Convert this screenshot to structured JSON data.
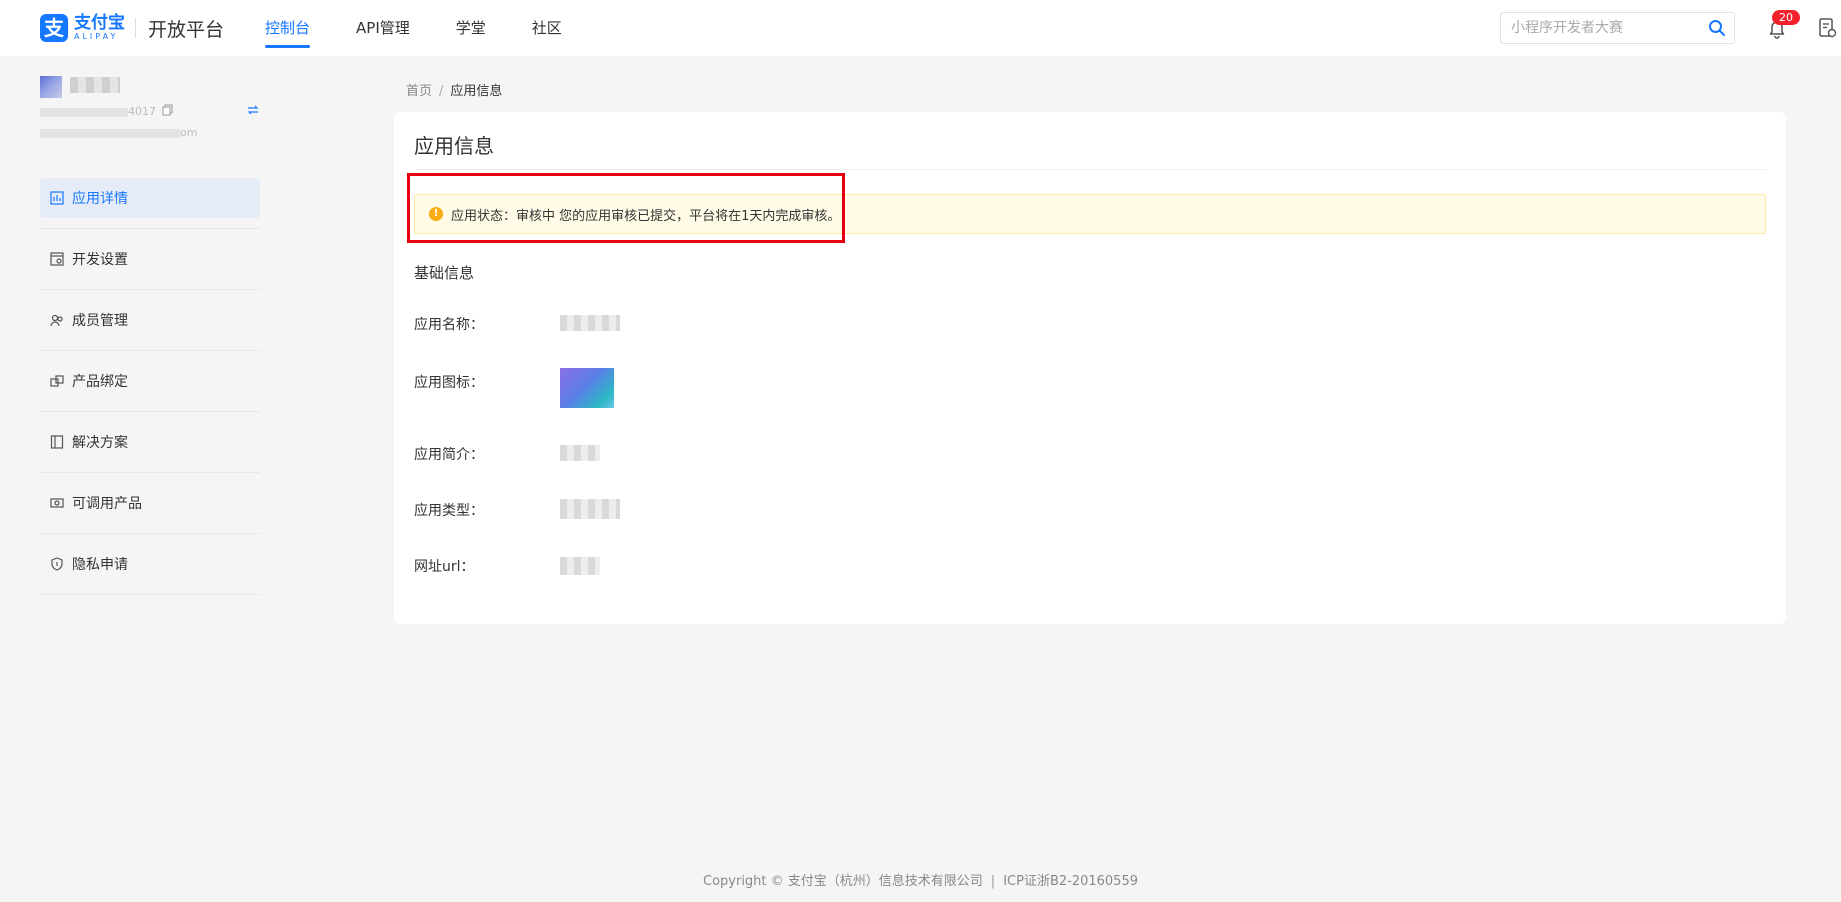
{
  "header": {
    "logo_cn": "支付宝",
    "logo_en": "ALIPAY",
    "platform": "开放平台",
    "nav": [
      {
        "label": "控制台",
        "active": true
      },
      {
        "label": "API管理"
      },
      {
        "label": "学堂"
      },
      {
        "label": "社区"
      }
    ],
    "search_placeholder": "小程序开发者大赛",
    "notification_count": "20",
    "icons": [
      "search-icon",
      "bell-icon",
      "document-icon"
    ]
  },
  "sidebar": {
    "account_id_suffix": "4017",
    "account_email_suffix": "om",
    "menu": [
      {
        "label": "应用详情",
        "icon": "chart-icon",
        "active": true
      },
      {
        "label": "开发设置",
        "icon": "settings-icon"
      },
      {
        "label": "成员管理",
        "icon": "members-icon"
      },
      {
        "label": "产品绑定",
        "icon": "link-icon"
      },
      {
        "label": "解决方案",
        "icon": "book-icon"
      },
      {
        "label": "可调用产品",
        "icon": "products-icon"
      },
      {
        "label": "隐私申请",
        "icon": "shield-icon"
      }
    ]
  },
  "breadcrumb": {
    "home": "首页",
    "separator": "/",
    "current": "应用信息"
  },
  "card": {
    "title": "应用信息",
    "alert": "应用状态：审核中 您的应用审核已提交，平台将在1天内完成审核。",
    "section_title": "基础信息",
    "fields": [
      {
        "label": "应用名称："
      },
      {
        "label": "应用图标："
      },
      {
        "label": "应用简介："
      },
      {
        "label": "应用类型："
      },
      {
        "label": "网址url："
      }
    ]
  },
  "footer": {
    "copyright": "Copyright © 支付宝（杭州）信息技术有限公司",
    "separator": "|",
    "icp": "ICP证浙B2-20160559"
  },
  "colors": {
    "accent": "#1677ff",
    "alert_bg": "#fffbe6",
    "highlight": "#e60012",
    "badge": "#f5222d"
  }
}
